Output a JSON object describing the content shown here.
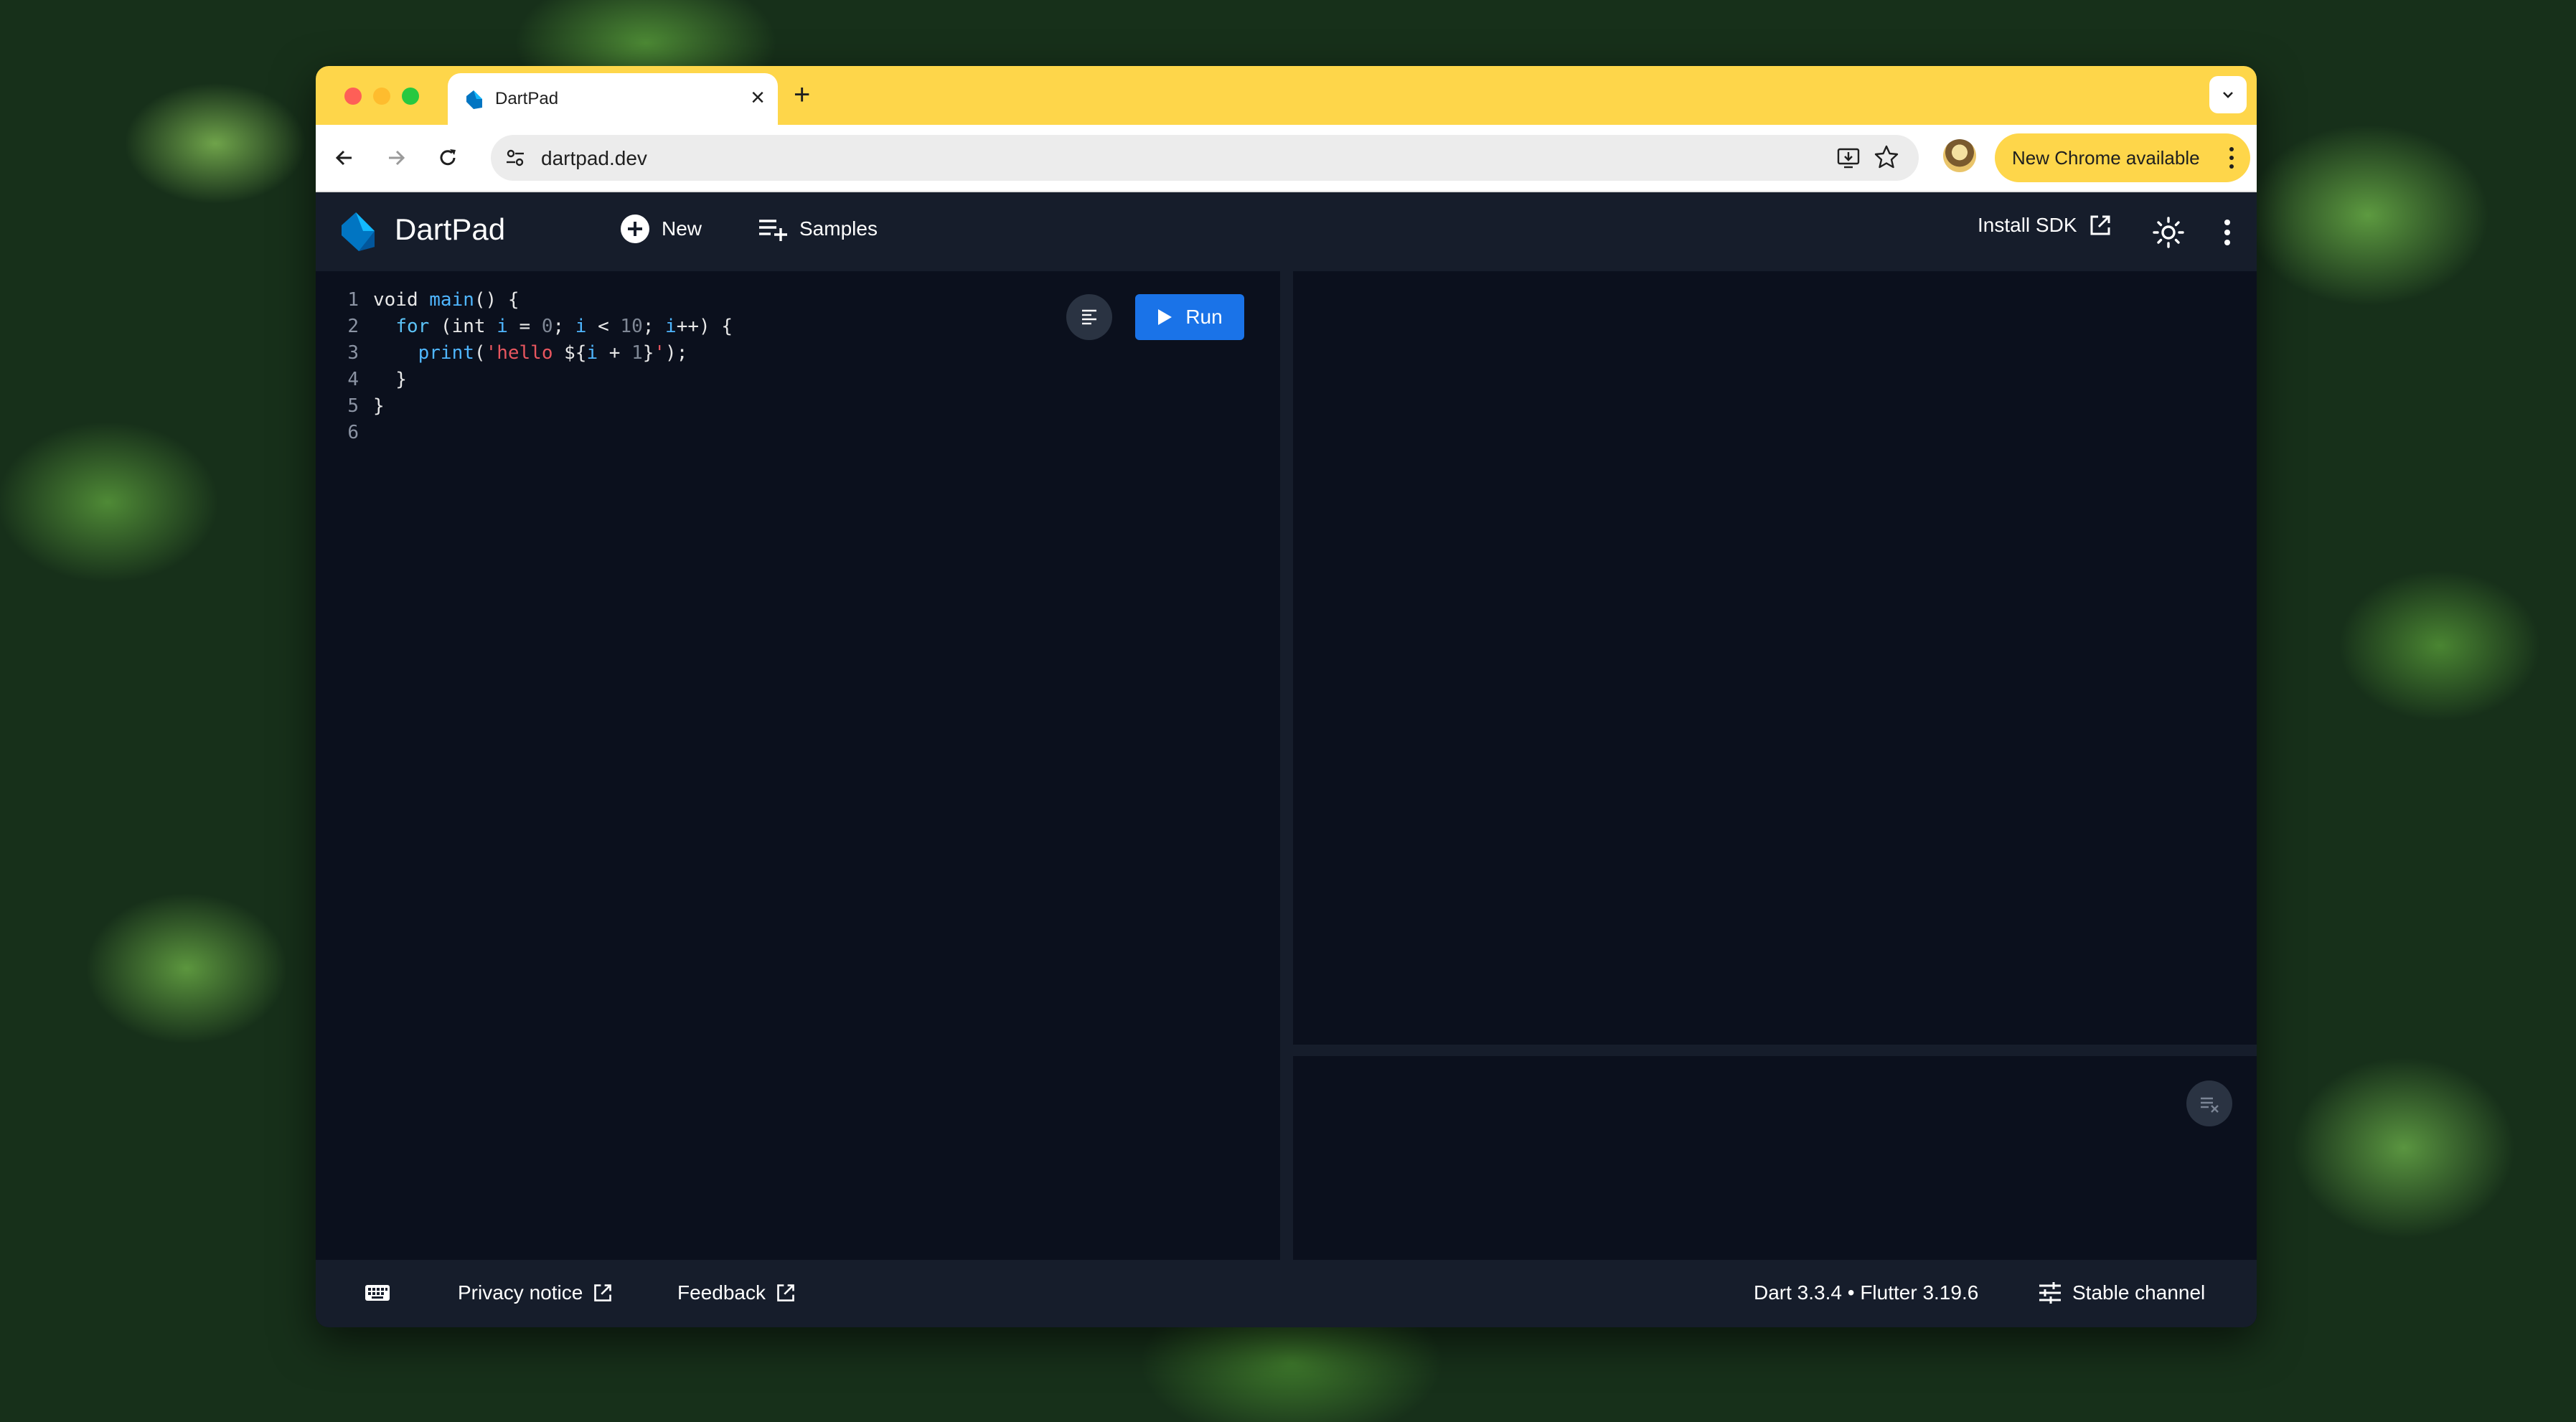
{
  "browser": {
    "tab_title": "DartPad",
    "url": "dartpad.dev",
    "update_badge": "New Chrome available"
  },
  "app": {
    "brand": "DartPad",
    "new_label": "New",
    "samples_label": "Samples",
    "install_sdk_label": "Install SDK",
    "run_label": "Run",
    "accent_color": "#1a73e8"
  },
  "editor": {
    "line_numbers": [
      "1",
      "2",
      "3",
      "4",
      "5",
      "6"
    ],
    "lines": [
      "void main() {",
      "  for (int i = 0; i < 10; i++) {",
      "    print('hello ${i + 1}');",
      "  }",
      "}",
      ""
    ]
  },
  "footer": {
    "privacy_label": "Privacy notice",
    "feedback_label": "Feedback",
    "version": "Dart 3.3.4 • Flutter 3.19.6",
    "channel_label": "Stable channel"
  }
}
